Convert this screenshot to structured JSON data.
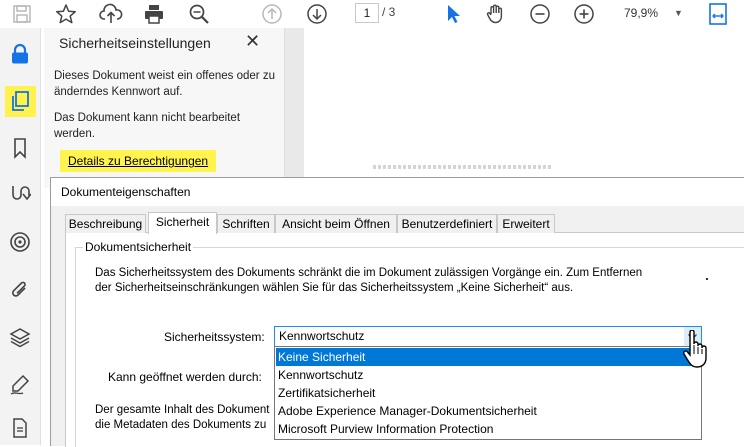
{
  "toolbar": {
    "page_current": "1",
    "page_total": "/ 3",
    "zoom": "79,9%"
  },
  "security_panel": {
    "title": "Sicherheitseinstellungen",
    "text1": "Dieses Dokument weist ein offenes oder zu änderndes Kennwort auf.",
    "text2": "Das Dokument kann nicht bearbeitet werden.",
    "link": "Details zu Berechtigungen"
  },
  "dialog": {
    "title": "Dokumenteigenschaften",
    "tabs": [
      "Beschreibung",
      "Sicherheit",
      "Schriften",
      "Ansicht beim Öffnen",
      "Benutzerdefiniert",
      "Erweitert"
    ],
    "active_tab": "Sicherheit",
    "group_label": "Dokumentsicherheit",
    "description": "Das Sicherheitssystem des Dokuments schränkt die im Dokument zulässigen Vorgänge ein. Zum Entfernen der Sicherheitseinschränkungen wählen Sie für das Sicherheitssystem „Keine Sicherheit“ aus.",
    "security_system_label": "Sicherheitssystem:",
    "security_system_value": "Kennwortschutz",
    "can_open_label": "Kann geöffnet werden durch:",
    "content_text_line1": "Der gesamte Inhalt des Dokument",
    "content_text_line2": "die Metadaten des Dokuments zu",
    "dropdown_options": [
      "Keine Sicherheit",
      "Kennwortschutz",
      "Zertifikatsicherheit",
      "Adobe Experience Manager-Dokumentsicherheit",
      "Microsoft Purview Information Protection"
    ],
    "highlighted_option": "Keine Sicherheit"
  },
  "colors": {
    "accent_blue": "#1473e6",
    "highlight_yellow": "#fff24d",
    "selection_blue": "#0078d7"
  }
}
